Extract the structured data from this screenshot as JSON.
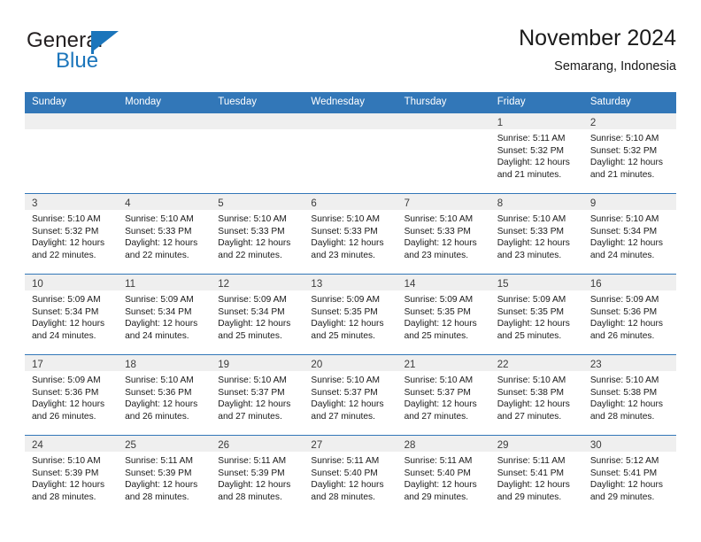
{
  "brand": {
    "name_part1": "General",
    "name_part2": "Blue",
    "flag_icon": "sail-flag-icon"
  },
  "header": {
    "title": "November 2024",
    "subtitle": "Semarang, Indonesia"
  },
  "calendar": {
    "weekday_headers": [
      "Sunday",
      "Monday",
      "Tuesday",
      "Wednesday",
      "Thursday",
      "Friday",
      "Saturday"
    ],
    "accent_color": "#3277b8",
    "daynum_band_color": "#efefef",
    "weeks": [
      [
        {
          "day": "",
          "lines": []
        },
        {
          "day": "",
          "lines": []
        },
        {
          "day": "",
          "lines": []
        },
        {
          "day": "",
          "lines": []
        },
        {
          "day": "",
          "lines": []
        },
        {
          "day": "1",
          "lines": [
            "Sunrise: 5:11 AM",
            "Sunset: 5:32 PM",
            "Daylight: 12 hours",
            "and 21 minutes."
          ]
        },
        {
          "day": "2",
          "lines": [
            "Sunrise: 5:10 AM",
            "Sunset: 5:32 PM",
            "Daylight: 12 hours",
            "and 21 minutes."
          ]
        }
      ],
      [
        {
          "day": "3",
          "lines": [
            "Sunrise: 5:10 AM",
            "Sunset: 5:32 PM",
            "Daylight: 12 hours",
            "and 22 minutes."
          ]
        },
        {
          "day": "4",
          "lines": [
            "Sunrise: 5:10 AM",
            "Sunset: 5:33 PM",
            "Daylight: 12 hours",
            "and 22 minutes."
          ]
        },
        {
          "day": "5",
          "lines": [
            "Sunrise: 5:10 AM",
            "Sunset: 5:33 PM",
            "Daylight: 12 hours",
            "and 22 minutes."
          ]
        },
        {
          "day": "6",
          "lines": [
            "Sunrise: 5:10 AM",
            "Sunset: 5:33 PM",
            "Daylight: 12 hours",
            "and 23 minutes."
          ]
        },
        {
          "day": "7",
          "lines": [
            "Sunrise: 5:10 AM",
            "Sunset: 5:33 PM",
            "Daylight: 12 hours",
            "and 23 minutes."
          ]
        },
        {
          "day": "8",
          "lines": [
            "Sunrise: 5:10 AM",
            "Sunset: 5:33 PM",
            "Daylight: 12 hours",
            "and 23 minutes."
          ]
        },
        {
          "day": "9",
          "lines": [
            "Sunrise: 5:10 AM",
            "Sunset: 5:34 PM",
            "Daylight: 12 hours",
            "and 24 minutes."
          ]
        }
      ],
      [
        {
          "day": "10",
          "lines": [
            "Sunrise: 5:09 AM",
            "Sunset: 5:34 PM",
            "Daylight: 12 hours",
            "and 24 minutes."
          ]
        },
        {
          "day": "11",
          "lines": [
            "Sunrise: 5:09 AM",
            "Sunset: 5:34 PM",
            "Daylight: 12 hours",
            "and 24 minutes."
          ]
        },
        {
          "day": "12",
          "lines": [
            "Sunrise: 5:09 AM",
            "Sunset: 5:34 PM",
            "Daylight: 12 hours",
            "and 25 minutes."
          ]
        },
        {
          "day": "13",
          "lines": [
            "Sunrise: 5:09 AM",
            "Sunset: 5:35 PM",
            "Daylight: 12 hours",
            "and 25 minutes."
          ]
        },
        {
          "day": "14",
          "lines": [
            "Sunrise: 5:09 AM",
            "Sunset: 5:35 PM",
            "Daylight: 12 hours",
            "and 25 minutes."
          ]
        },
        {
          "day": "15",
          "lines": [
            "Sunrise: 5:09 AM",
            "Sunset: 5:35 PM",
            "Daylight: 12 hours",
            "and 25 minutes."
          ]
        },
        {
          "day": "16",
          "lines": [
            "Sunrise: 5:09 AM",
            "Sunset: 5:36 PM",
            "Daylight: 12 hours",
            "and 26 minutes."
          ]
        }
      ],
      [
        {
          "day": "17",
          "lines": [
            "Sunrise: 5:09 AM",
            "Sunset: 5:36 PM",
            "Daylight: 12 hours",
            "and 26 minutes."
          ]
        },
        {
          "day": "18",
          "lines": [
            "Sunrise: 5:10 AM",
            "Sunset: 5:36 PM",
            "Daylight: 12 hours",
            "and 26 minutes."
          ]
        },
        {
          "day": "19",
          "lines": [
            "Sunrise: 5:10 AM",
            "Sunset: 5:37 PM",
            "Daylight: 12 hours",
            "and 27 minutes."
          ]
        },
        {
          "day": "20",
          "lines": [
            "Sunrise: 5:10 AM",
            "Sunset: 5:37 PM",
            "Daylight: 12 hours",
            "and 27 minutes."
          ]
        },
        {
          "day": "21",
          "lines": [
            "Sunrise: 5:10 AM",
            "Sunset: 5:37 PM",
            "Daylight: 12 hours",
            "and 27 minutes."
          ]
        },
        {
          "day": "22",
          "lines": [
            "Sunrise: 5:10 AM",
            "Sunset: 5:38 PM",
            "Daylight: 12 hours",
            "and 27 minutes."
          ]
        },
        {
          "day": "23",
          "lines": [
            "Sunrise: 5:10 AM",
            "Sunset: 5:38 PM",
            "Daylight: 12 hours",
            "and 28 minutes."
          ]
        }
      ],
      [
        {
          "day": "24",
          "lines": [
            "Sunrise: 5:10 AM",
            "Sunset: 5:39 PM",
            "Daylight: 12 hours",
            "and 28 minutes."
          ]
        },
        {
          "day": "25",
          "lines": [
            "Sunrise: 5:11 AM",
            "Sunset: 5:39 PM",
            "Daylight: 12 hours",
            "and 28 minutes."
          ]
        },
        {
          "day": "26",
          "lines": [
            "Sunrise: 5:11 AM",
            "Sunset: 5:39 PM",
            "Daylight: 12 hours",
            "and 28 minutes."
          ]
        },
        {
          "day": "27",
          "lines": [
            "Sunrise: 5:11 AM",
            "Sunset: 5:40 PM",
            "Daylight: 12 hours",
            "and 28 minutes."
          ]
        },
        {
          "day": "28",
          "lines": [
            "Sunrise: 5:11 AM",
            "Sunset: 5:40 PM",
            "Daylight: 12 hours",
            "and 29 minutes."
          ]
        },
        {
          "day": "29",
          "lines": [
            "Sunrise: 5:11 AM",
            "Sunset: 5:41 PM",
            "Daylight: 12 hours",
            "and 29 minutes."
          ]
        },
        {
          "day": "30",
          "lines": [
            "Sunrise: 5:12 AM",
            "Sunset: 5:41 PM",
            "Daylight: 12 hours",
            "and 29 minutes."
          ]
        }
      ]
    ]
  }
}
